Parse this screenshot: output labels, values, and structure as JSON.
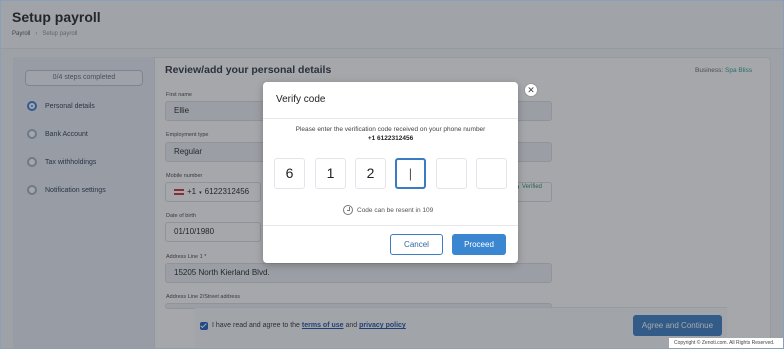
{
  "page": {
    "title": "Setup payroll",
    "breadcrumb": [
      "Payroll",
      "Setup payroll"
    ]
  },
  "sidebar": {
    "progress": "0/4 steps completed",
    "steps": [
      {
        "label": "Personal details",
        "active": true
      },
      {
        "label": "Bank Account",
        "active": false
      },
      {
        "label": "Tax withholdings",
        "active": false
      },
      {
        "label": "Notification settings",
        "active": false
      }
    ]
  },
  "form": {
    "title": "Review/add your personal details",
    "business_label": "Business:",
    "business_name": "Spa Bliss",
    "first_name": {
      "label": "First name",
      "value": "Ellie"
    },
    "employment_type": {
      "label": "Employment type",
      "value": "Regular"
    },
    "mobile": {
      "label": "Mobile number",
      "country_code": "+1",
      "value": "6122312456",
      "status": "Verified"
    },
    "dob": {
      "label": "Date of birth",
      "value": "01/10/1980"
    },
    "address1": {
      "label": "Address Line 1 *",
      "value": "15205 North Kierland Blvd."
    },
    "address2": {
      "label": "Address Line 2/Street address",
      "value": ""
    },
    "agree": {
      "prefix": "I have read and agree to the",
      "terms": "terms of use",
      "and": "and",
      "privacy": "privacy policy",
      "checked": true
    },
    "agree_button": "Agree and Continue"
  },
  "modal": {
    "title": "Verify code",
    "message": "Please enter the verification code received on your phone number",
    "phone": "+1 6122312456",
    "digits": [
      "6",
      "1",
      "2",
      "|",
      "",
      ""
    ],
    "resend": "Code can be resent in 109",
    "cancel": "Cancel",
    "proceed": "Proceed"
  },
  "footer": {
    "copyright": "Copyright © Zenoti.com. All Rights Reserved."
  },
  "colors": {
    "accent": "#3a7cc1",
    "verified": "#2e8b57",
    "business": "#2a9d8f"
  }
}
